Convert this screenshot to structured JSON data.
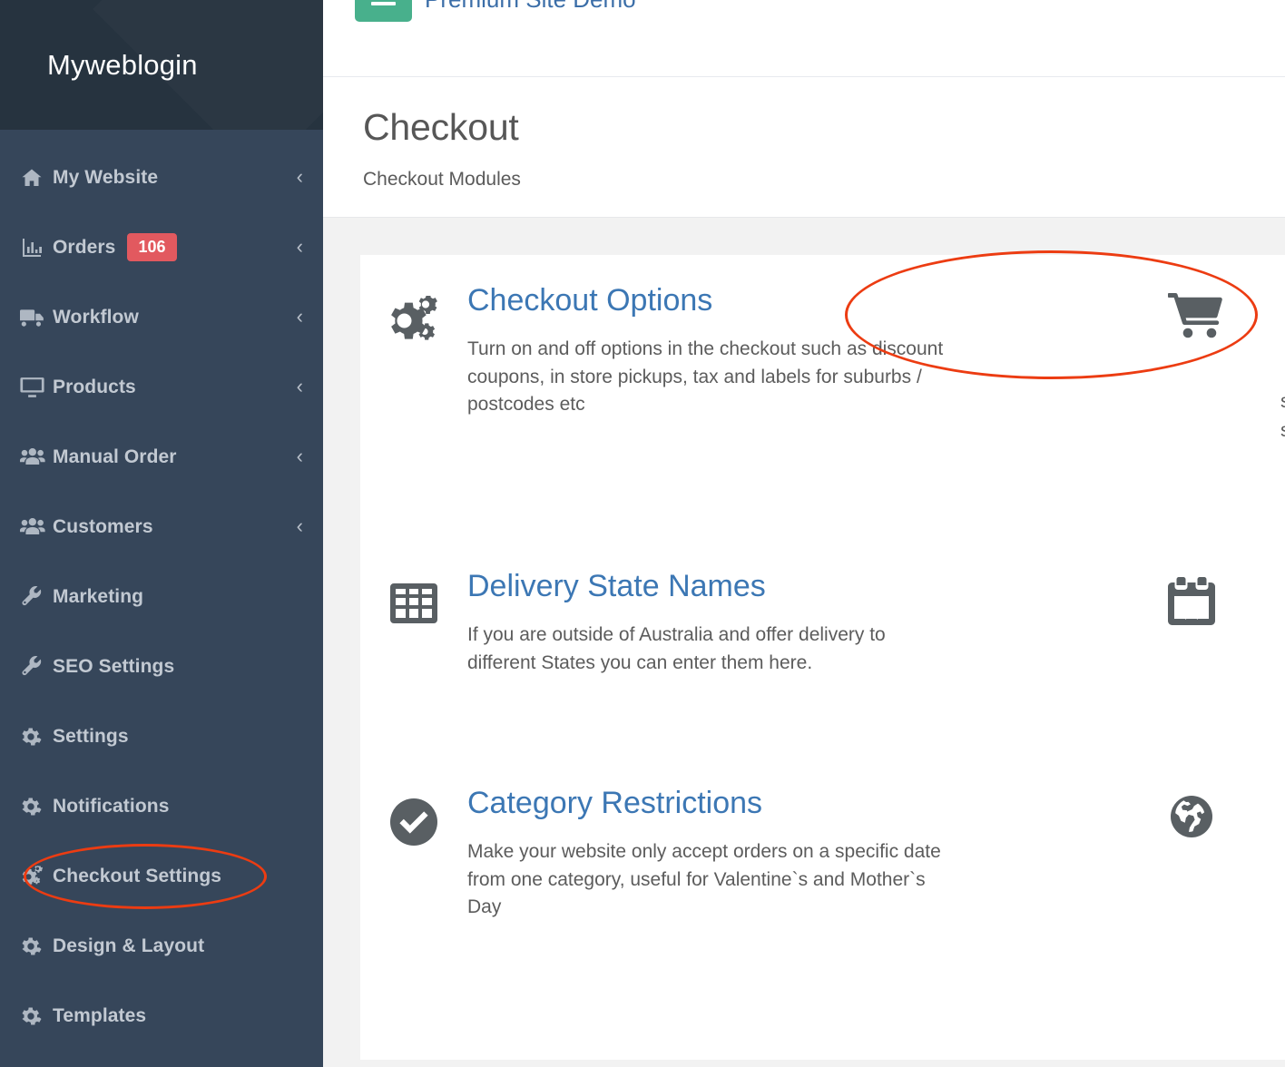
{
  "sidebar": {
    "brand": "Myweblogin",
    "items": [
      {
        "label": "My Website",
        "icon": "home-icon",
        "caret": "‹",
        "badge": null
      },
      {
        "label": "Orders",
        "icon": "chart-icon",
        "caret": "‹",
        "badge": "106"
      },
      {
        "label": "Workflow",
        "icon": "truck-icon",
        "caret": "‹",
        "badge": null
      },
      {
        "label": "Products",
        "icon": "monitor-icon",
        "caret": "‹",
        "badge": null
      },
      {
        "label": "Manual Order",
        "icon": "users-icon",
        "caret": "‹",
        "badge": null
      },
      {
        "label": "Customers",
        "icon": "users-icon",
        "caret": "‹",
        "badge": null
      },
      {
        "label": "Marketing",
        "icon": "wrench-icon",
        "caret": "",
        "badge": null
      },
      {
        "label": "SEO Settings",
        "icon": "wrench-icon",
        "caret": "",
        "badge": null
      },
      {
        "label": "Settings",
        "icon": "gear-icon",
        "caret": "",
        "badge": null
      },
      {
        "label": "Notifications",
        "icon": "gear-icon",
        "caret": "",
        "badge": null
      },
      {
        "label": "Checkout Settings",
        "icon": "cogs-icon",
        "caret": "",
        "badge": null
      },
      {
        "label": "Design & Layout",
        "icon": "gear-icon",
        "caret": "",
        "badge": null
      },
      {
        "label": "Templates",
        "icon": "gear-icon",
        "caret": "",
        "badge": null
      }
    ]
  },
  "topbar": {
    "menu_icon": "hamburger-icon",
    "site_name": "Premium Site Demo"
  },
  "page": {
    "title": "Checkout",
    "subtitle": "Checkout Modules"
  },
  "modules": [
    {
      "title": "Checkout Options",
      "description": "Turn on and off options in the checkout such as discount coupons, in store pickups, tax and labels for suburbs / postcodes etc",
      "left_icon": "cogs-icon",
      "right_icon": "shopping-cart-icon",
      "edge_text": "s"
    },
    {
      "title": "Delivery State Names",
      "description": "If you are outside of Australia and offer delivery to different States you can enter them here.",
      "left_icon": "table-grid-icon",
      "right_icon": "calendar-times-icon",
      "edge_text": ""
    },
    {
      "title": "Category Restrictions",
      "description": "Make your website only accept orders on a specific date from one category, useful for Valentine`s and Mother`s Day",
      "left_icon": "check-circle-icon",
      "right_icon": "globe-icon",
      "edge_text": ""
    }
  ],
  "annotations": {
    "highlight_color": "#ec3c12",
    "sidebar_target": "Checkout Settings",
    "main_target": "Checkout Options"
  },
  "colors": {
    "sidebar_bg": "#36465a",
    "sidebar_brand_bg": "#26333f",
    "badge": "#e2595f",
    "link_blue": "#3c77b4",
    "accent_green": "#48b08c",
    "page_bg": "#f2f2f2"
  }
}
